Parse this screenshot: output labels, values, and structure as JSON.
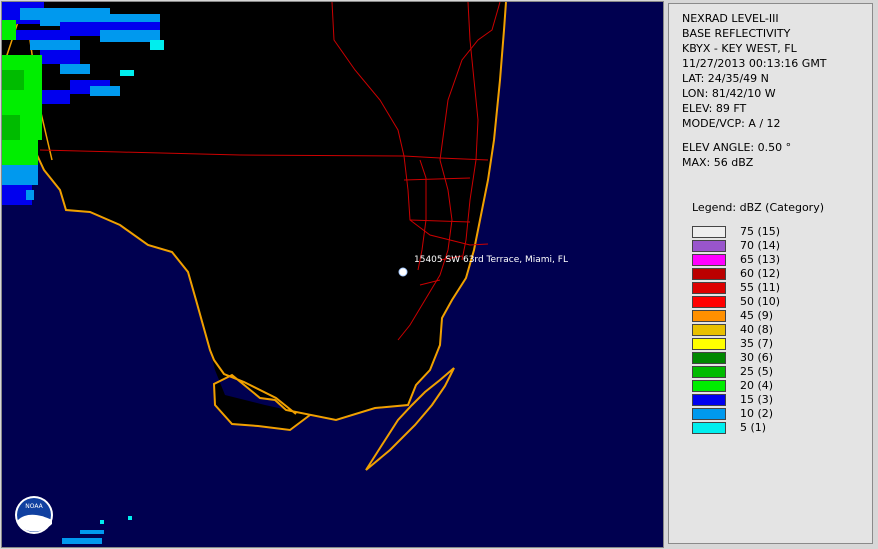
{
  "info": {
    "product": "NEXRAD LEVEL-III",
    "type": "BASE REFLECTIVITY",
    "station": "KBYX - KEY WEST, FL",
    "datetime": "11/27/2013 00:13:16 GMT",
    "lat": "LAT: 24/35/49 N",
    "lon": "LON: 81/42/10 W",
    "elev": "ELEV: 89 FT",
    "mode": "MODE/VCP: A / 12",
    "elev_angle": "ELEV ANGLE: 0.50 °",
    "max": "MAX: 56 dBZ"
  },
  "legend": {
    "title": "Legend: dBZ (Category)",
    "items": [
      {
        "label": "75  (15)",
        "color": "#eeeeee"
      },
      {
        "label": "70  (14)",
        "color": "#9955cc"
      },
      {
        "label": "65  (13)",
        "color": "#ff00ff"
      },
      {
        "label": "60  (12)",
        "color": "#bb0000"
      },
      {
        "label": "55  (11)",
        "color": "#dd0000"
      },
      {
        "label": "50  (10)",
        "color": "#ff0000"
      },
      {
        "label": "45  (9)",
        "color": "#ff9000"
      },
      {
        "label": "40  (8)",
        "color": "#e8c000"
      },
      {
        "label": "35  (7)",
        "color": "#ffff00"
      },
      {
        "label": "30  (6)",
        "color": "#008800"
      },
      {
        "label": "25  (5)",
        "color": "#00bb00"
      },
      {
        "label": "20  (4)",
        "color": "#00ee00"
      },
      {
        "label": "15  (3)",
        "color": "#0000ee"
      },
      {
        "label": "10  (2)",
        "color": "#0099ee"
      },
      {
        "label": "5  (1)",
        "color": "#00eeee"
      }
    ]
  },
  "map": {
    "location_label": "15405 SW 63rd Terrace, Miami, FL",
    "logo_text": "NOAA",
    "colors": {
      "ocean": "#000050",
      "land": "#000000",
      "coastline": "#f0a000",
      "roads": "#cc0000"
    }
  }
}
